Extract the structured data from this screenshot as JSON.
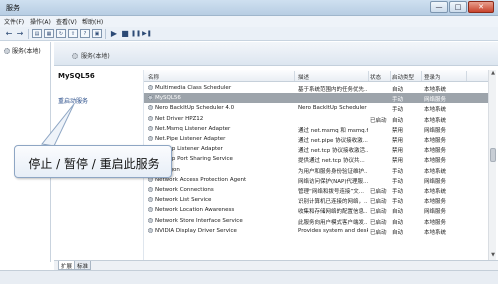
{
  "window": {
    "title": "服务",
    "controls": [
      "—",
      "□",
      "✕"
    ]
  },
  "menu": [
    "文件(F)",
    "操作(A)",
    "查看(V)",
    "帮助(H)"
  ],
  "toolbar": {
    "back_icon": "arrow-left-icon",
    "forward_icon": "arrow-right-icon",
    "buttons": [
      "▶",
      "■",
      "❚❚",
      "▶❚"
    ]
  },
  "tree": {
    "root_label": "服务(本地)"
  },
  "header": {
    "title": "服务(本地)"
  },
  "detail": {
    "service_name": "MySQL56",
    "restart_link": "重启动服务"
  },
  "columns": [
    "名称",
    "描述",
    "状态",
    "启动类型",
    "登录为"
  ],
  "services": [
    {
      "name": "Multimedia Class Scheduler",
      "desc": "基于系统范围内的任务优先...",
      "status": "",
      "startup": "自动",
      "logon": "本地系统",
      "selected": false
    },
    {
      "name": "MySQL56",
      "desc": "",
      "status": "",
      "startup": "手动",
      "logon": "网络服务",
      "selected": true
    },
    {
      "name": "Nero BackItUp Scheduler 4.0",
      "desc": "Nero BackItUp Scheduler ...",
      "status": "",
      "startup": "手动",
      "logon": "本地系统",
      "selected": false
    },
    {
      "name": "Net Driver HPZ12",
      "desc": "",
      "status": "已启动",
      "startup": "自动",
      "logon": "本地系统",
      "selected": false
    },
    {
      "name": "Net.Msmq Listener Adapter",
      "desc": "通过 net.msmq 和 msmq.f...",
      "status": "",
      "startup": "禁用",
      "logon": "网络服务",
      "selected": false
    },
    {
      "name": "Net.Pipe Listener Adapter",
      "desc": "通过 net.pipe 协议接收激...",
      "status": "",
      "startup": "禁用",
      "logon": "本地服务",
      "selected": false
    },
    {
      "name": "Net.Tcp Listener Adapter",
      "desc": "通过 net.tcp 协议接收激活...",
      "status": "",
      "startup": "禁用",
      "logon": "本地服务",
      "selected": false
    },
    {
      "name": "Net.Tcp Port Sharing Service",
      "desc": "提供通过 net.tcp 协议共...",
      "status": "",
      "startup": "禁用",
      "logon": "本地服务",
      "selected": false
    },
    {
      "name": "Netlogon",
      "desc": "为用户和服务身份验证维护...",
      "status": "",
      "startup": "手动",
      "logon": "本地系统",
      "selected": false
    },
    {
      "name": "Network Access Protection Agent",
      "desc": "网络访问保护(NAP)代理服...",
      "status": "",
      "startup": "手动",
      "logon": "网络服务",
      "selected": false
    },
    {
      "name": "Network Connections",
      "desc": "管理“网络和拨号连接”文...",
      "status": "已启动",
      "startup": "手动",
      "logon": "本地系统",
      "selected": false
    },
    {
      "name": "Network List Service",
      "desc": "识别计算机已连接的网络，...",
      "status": "已启动",
      "startup": "手动",
      "logon": "本地服务",
      "selected": false
    },
    {
      "name": "Network Location Awareness",
      "desc": "收集和存储网络的配置信息...",
      "status": "已启动",
      "startup": "自动",
      "logon": "网络服务",
      "selected": false
    },
    {
      "name": "Network Store Interface Service",
      "desc": "此服务向用户模式客户端发...",
      "status": "已启动",
      "startup": "自动",
      "logon": "本地服务",
      "selected": false
    },
    {
      "name": "NVIDIA Display Driver Service",
      "desc": "Provides system and deskt...",
      "status": "已启动",
      "startup": "自动",
      "logon": "本地系统",
      "selected": false
    }
  ],
  "bottom_tabs": [
    "扩展",
    "标准"
  ],
  "callout": {
    "text": "停止 / 暂停 / 重启此服务"
  }
}
